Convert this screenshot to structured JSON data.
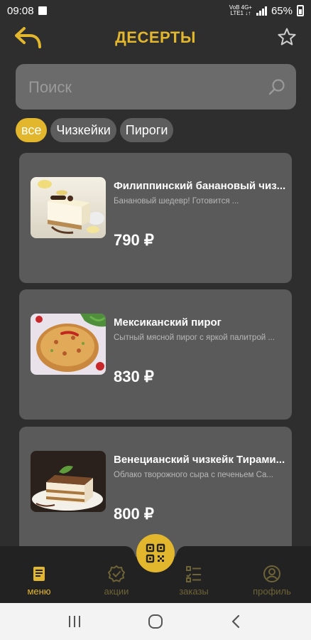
{
  "status_bar": {
    "time": "09:08",
    "network_top": "VoB 4G+",
    "network_bottom": "LTE1 ↓↑",
    "battery": "65%"
  },
  "header": {
    "title": "ДЕСЕРТЫ"
  },
  "search": {
    "placeholder": "Поиск"
  },
  "filters": [
    {
      "label": "все",
      "active": true
    },
    {
      "label": "Чизкейки",
      "active": false
    },
    {
      "label": "Пироги",
      "active": false
    }
  ],
  "products": [
    {
      "name": "Филиппинский банановый чиз...",
      "description": "Банановый шедевр! Готовится ...",
      "price": "790 ₽",
      "image": "banana-cheesecake-photo"
    },
    {
      "name": "Мексиканский пирог",
      "description": "Сытный мясной пирог с яркой палитрой ...",
      "price": "830 ₽",
      "image": "mexican-pie-photo"
    },
    {
      "name": "Венецианский чизкейк Тирами...",
      "description": "Облако творожного сыра с печеньем Са...",
      "price": "800 ₽",
      "image": "tiramisu-cheesecake-photo"
    }
  ],
  "bottom_nav": [
    {
      "label": "меню",
      "icon": "menu-book-icon",
      "active": true
    },
    {
      "label": "акции",
      "icon": "badge-check-icon",
      "active": false
    },
    {
      "label": "заказы",
      "icon": "checklist-icon",
      "active": false
    },
    {
      "label": "профиль",
      "icon": "profile-icon",
      "active": false
    }
  ],
  "colors": {
    "accent": "#e2b62d",
    "background": "#2e2e2e",
    "card": "#5a5a5a",
    "search": "#6b6b6b"
  }
}
